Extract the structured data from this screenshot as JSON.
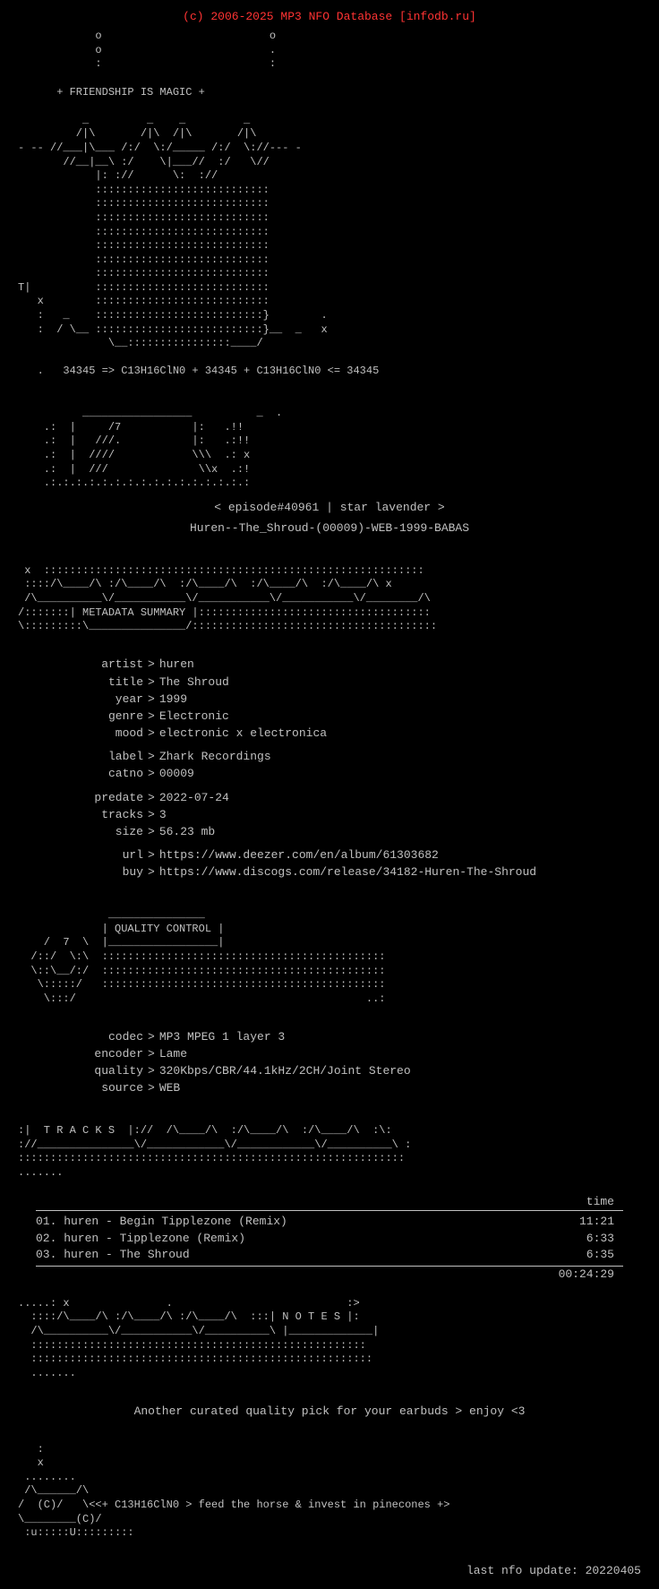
{
  "header": {
    "credit": "(c) 2006-2025 MP3 NFO Database [infodb.ru]"
  },
  "ascii": {
    "friendship": "+ FRIENDSHIP IS MAGIC +",
    "art1": "            o                          o\n            o                          .\n            :                          :\n\n      + FRIENDSHIP IS MAGIC +\n\n          _         _    _         _\n         /|\\       /|\\  /|\\       /|\\\n- -- //___|\\____ /:/  \\:/_____ /:/  \\://--- -\n       //__|__\\  :/    \\|___//  :/   \\//\n            |:  ://      \\:  ://\n            :::::::::::::::::::::::::::\n            :::::::::::::::::::::::::::\n            :::::::::::::::::::::::::::\n            :::::::::::::::::::::::::::\n            :::::::::::::::::::::::::::\n            :::::::::::::::::::::::::::\n            :::::::::::::::::::::::::::\nT|          :::::::::::::::::::::::::::\n   x        :::::::::::::::::::::::::::\n   :   _    ::::::::::::::::::::::::::}        .\n   :  / \\__ ::::::::::::::::::::::::::}__  _   x\n              \\__::::::::::::::::____/",
    "formula": "   .   34345 => C13H16ClN0 + 34345 + C13H16ClN0 <= 34345",
    "art2": "          _________________          _  .\n    .:  |     /7           |:   .!!\n    .:  |   ///.           |:   .:!!\n    .:  |  ////            \\\\\\  .: x\n    .:  |  ///              \\\\x  .:!\n    .:.:.:.:.:.:.:.:.:.:.:.:.:.:.:.:",
    "metadata_banner": "x  ::::::::::::::::::::::::::::::::::::::::::::::::::::::::::\n ::::/\\____/\\ :/\\____/\\  :/\\____/\\  :/\\____/\\  :/\\____/\\ x\n /___________\\/__________\\/___________\\/___________\\/__________\\\n/::::::| METADATA SUMMARY |::::::::::::::::::::::::::::::::::::\n::::::::\\_______________/::::::::::::::::::::::::::::::::::::::::",
    "qc_banner": "              _______________\n             | QUALITY CONTROL |\n    /  7  \\  |_________________|\n  /::/  \\:\\  ::::::::::::::::::::::::::::::::::::::::::::\n  \\::\\__/:/  ::::::::::::::::::::::::::::::::::::::::::::\n   \\::::::/  ::::::::::::::::::::::::::::::::::::::::::::\n    \\::::/                                            ..:",
    "tracks_banner": ":|  T R A C K S  |://  /\\____/\\  :/\\____/\\  :/\\____/\\  :\\:\n://________________\\/____________\\/____________\\/__________\\ :\n::::::::::::::::::::::::::::::::::::::::::::::::::::::::::::\n.......",
    "notes_banner": ".....: x               .                           :>\n  ::::/\\____/\\ :/\\____/\\ :/\\____/\\  :::| N O T E S |:\n  /___________\\/__________\\/__________\\ |_____________|\n  ::::::::::::::::::::::::::::::::::::::::::::::::::::\n  :::::::::::::::::::::::::::::::::::::::::::::::::::::\n  .......",
    "footer_art": "   :\n   x\n ........\n /\\______/\\\n/  (C)/   \\<<+ C13H16ClN0 > feed the horse & invest in pinecones +>\n\\________(C)/\n :u:::::U:::::::::"
  },
  "episode": "< episode#40961 | star lavender >",
  "release": "Huren--The_Shroud-(00009)-WEB-1999-BABAS",
  "metadata": {
    "artist": "huren",
    "title": "The Shroud",
    "year": "1999",
    "genre": "Electronic",
    "mood": "electronic x electronica",
    "label": "Zhark Recordings",
    "catno": "00009",
    "predate": "2022-07-24",
    "tracks": "3",
    "size": "56.23 mb",
    "url": "https://www.deezer.com/en/album/61303682",
    "buy": "https://www.discogs.com/release/34182-Huren-The-Shroud"
  },
  "quality": {
    "codec": "MP3 MPEG 1 layer 3",
    "encoder": "Lame",
    "quality": "320Kbps/CBR/44.1kHz/2CH/Joint Stereo",
    "source": "WEB"
  },
  "tracks": {
    "header": "time",
    "separator": "--------",
    "items": [
      {
        "num": "01.",
        "name": "huren - Begin Tipplezone (Remix)",
        "time": "11:21"
      },
      {
        "num": "02.",
        "name": "huren - Tipplezone (Remix)",
        "time": "6:33"
      },
      {
        "num": "03.",
        "name": "huren - The Shroud",
        "time": "6:35"
      }
    ],
    "total": "00:24:29"
  },
  "notes": {
    "text": "Another curated quality pick for your earbuds > enjoy <3"
  },
  "footer": {
    "update": "last nfo update: 20220405"
  }
}
